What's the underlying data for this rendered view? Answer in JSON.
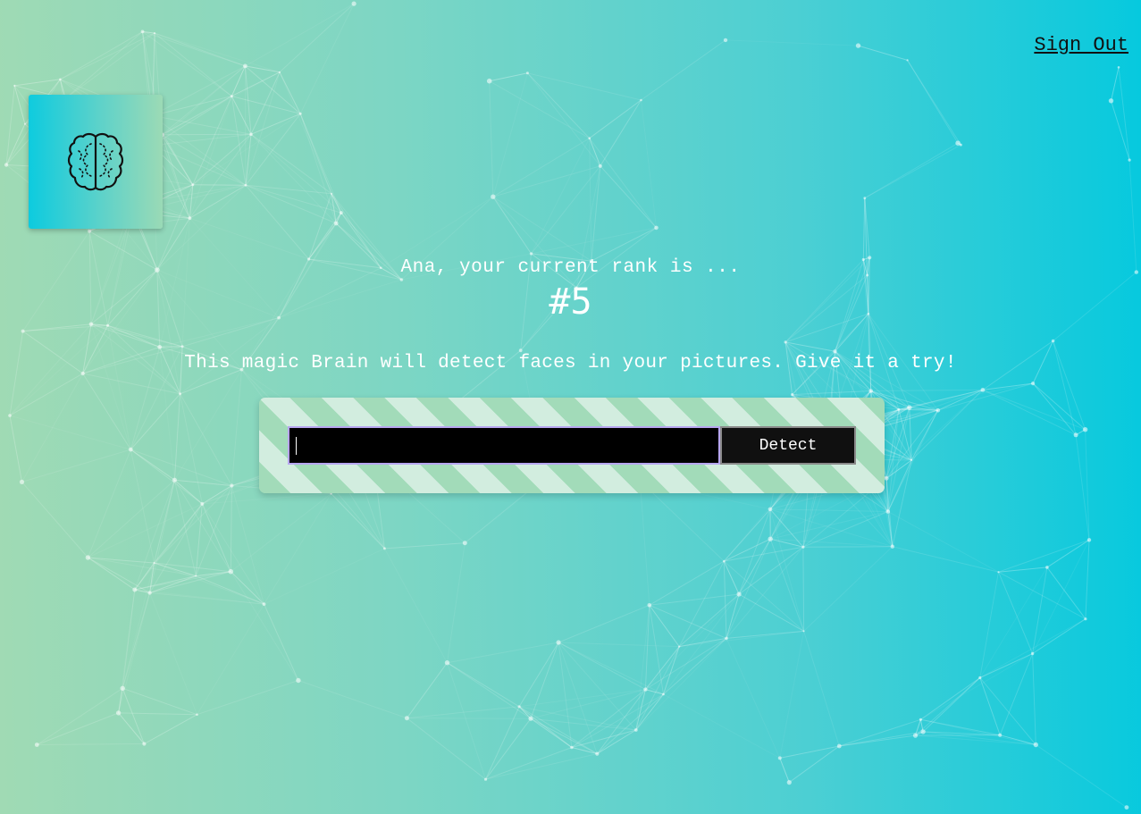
{
  "nav": {
    "signout_label": "Sign Out"
  },
  "logo": {
    "icon": "brain-icon"
  },
  "rank": {
    "message": "Ana, your current rank is ...",
    "value": "#5"
  },
  "intro": {
    "text": "This magic Brain will detect faces in your pictures. Give it a try!"
  },
  "image_form": {
    "input_value": "",
    "button_label": "Detect"
  },
  "colors": {
    "gradient_start": "#a0dab4",
    "gradient_end": "#06c9de",
    "stripe_dark": "#a2dbb9",
    "stripe_light": "#d2eddf",
    "input_border": "#b7a6f0",
    "button_bg": "#101010"
  }
}
